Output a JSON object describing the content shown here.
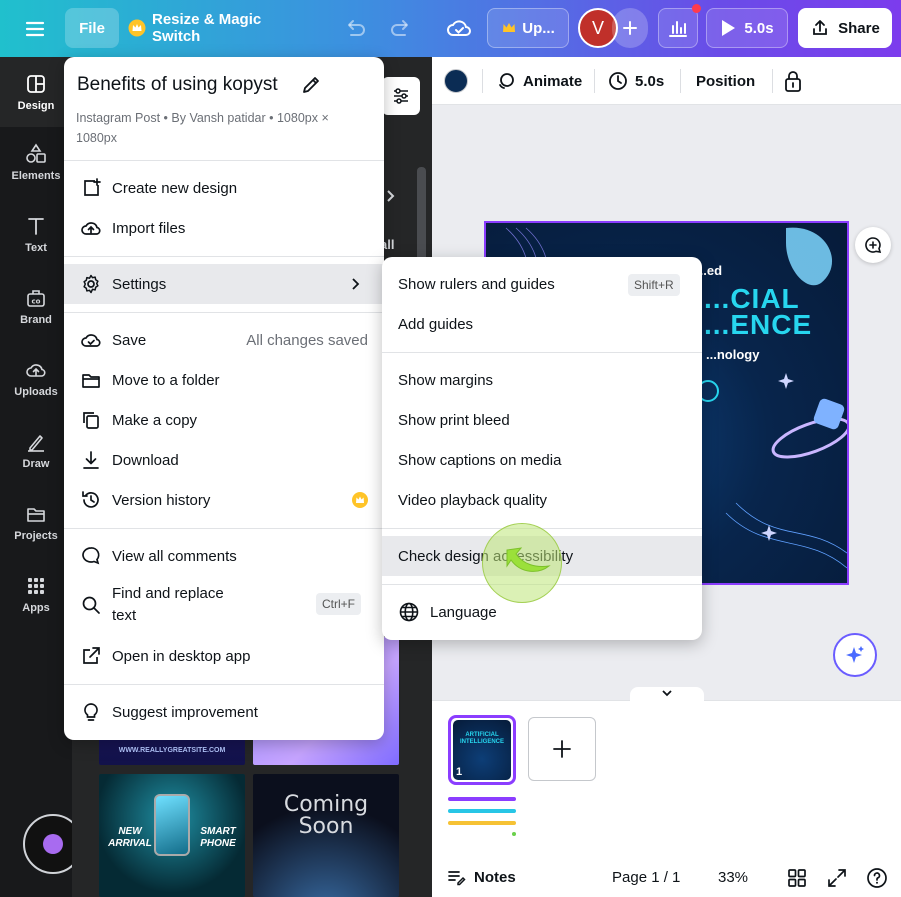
{
  "topbar": {
    "file": "File",
    "resize": "Resize & Magic Switch",
    "upgrade": "Up...",
    "avatar": "V",
    "duration": "5.0s",
    "share": "Share"
  },
  "rail": [
    {
      "label": "Design",
      "icon": "design-icon"
    },
    {
      "label": "Elements",
      "icon": "elements-icon"
    },
    {
      "label": "Text",
      "icon": "text-icon"
    },
    {
      "label": "Brand",
      "icon": "brand-icon"
    },
    {
      "label": "Uploads",
      "icon": "uploads-icon"
    },
    {
      "label": "Draw",
      "icon": "draw-icon"
    },
    {
      "label": "Projects",
      "icon": "projects-icon"
    },
    {
      "label": "Apps",
      "icon": "apps-icon"
    }
  ],
  "panel": {
    "partial_label": "all",
    "thumb_site": "WWW.REALLYGREATSITE.COM",
    "thumb_new_arrival": "NEW ARRIVAL",
    "thumb_smart_phone": "SMART PHONE",
    "thumb_coming_soon": "Coming Soon"
  },
  "toolbar2": {
    "animate": "Animate",
    "duration": "5.0s",
    "position": "Position",
    "color": "#0b2c54"
  },
  "canvas": {
    "line1": "...ed",
    "line2": "...CIAL",
    "line3": "...ENCE",
    "line4": "...nology"
  },
  "file_menu": {
    "title": "Benefits of using kopyst",
    "subtitle": "Instagram Post • By Vansh patidar • 1080px × 1080px",
    "items": {
      "create": "Create new design",
      "import": "Import files",
      "settings": "Settings",
      "save": "Save",
      "save_status": "All changes saved",
      "move": "Move to a folder",
      "copy": "Make a copy",
      "download": "Download",
      "version": "Version history",
      "comments": "View all comments",
      "find": "Find and replace text",
      "find_shortcut": "Ctrl+F",
      "desktop": "Open in desktop app",
      "suggest": "Suggest improvement"
    }
  },
  "settings_menu": {
    "rulers": "Show rulers and guides",
    "rulers_shortcut": "Shift+R",
    "add_guides": "Add guides",
    "margins": "Show margins",
    "print_bleed": "Show print bleed",
    "captions": "Show captions on media",
    "playback": "Video playback quality",
    "accessibility": "Check design accessibility",
    "language": "Language"
  },
  "bottom": {
    "page_number": "1",
    "notes": "Notes",
    "page": "Page 1 / 1",
    "zoom": "33%",
    "thumb_title": "ARTIFICIAL INTELLIGENCE"
  },
  "colors": {
    "accent": "#8b3dff",
    "menu_highlight": "#e8e9ec",
    "click_marker": "#9be03a"
  }
}
